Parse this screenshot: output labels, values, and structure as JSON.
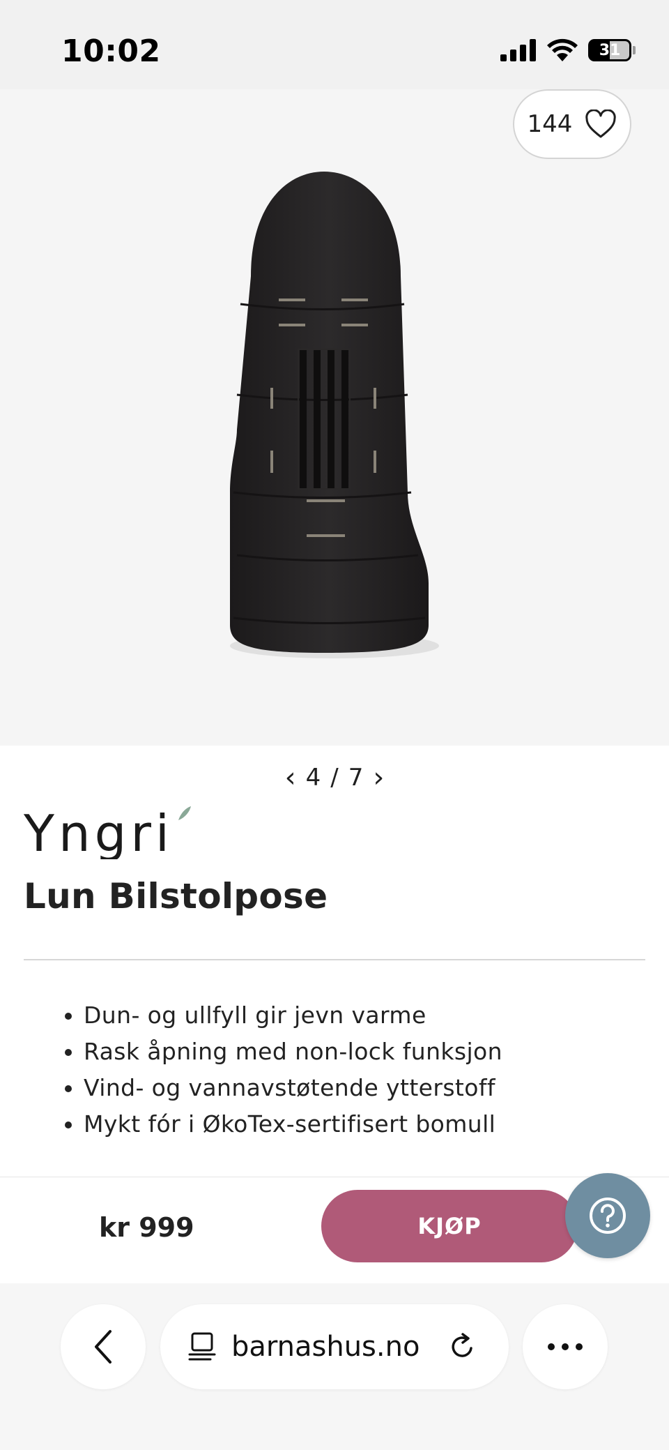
{
  "status_bar": {
    "time": "10:02",
    "battery": "31"
  },
  "gallery": {
    "like_count": "144",
    "pager_current": "4",
    "pager_separator": "/",
    "pager_total": "7"
  },
  "product": {
    "brand": "Yngri",
    "name": "Lun Bilstolpose",
    "features": [
      "Dun- og ullfyll gir jevn varme",
      "Rask åpning med non-lock funksjon",
      "Vind- og vannavstøtende ytterstoff",
      "Mykt fór i ØkoTex-sertifisert bomull"
    ],
    "price": "kr 999",
    "buy_label": "KJØP"
  },
  "browser": {
    "url": "barnashus.no"
  },
  "colors": {
    "buy_button": "#b05a78",
    "help_button": "#6f8ea1",
    "gallery_bg": "#f5f5f5"
  }
}
